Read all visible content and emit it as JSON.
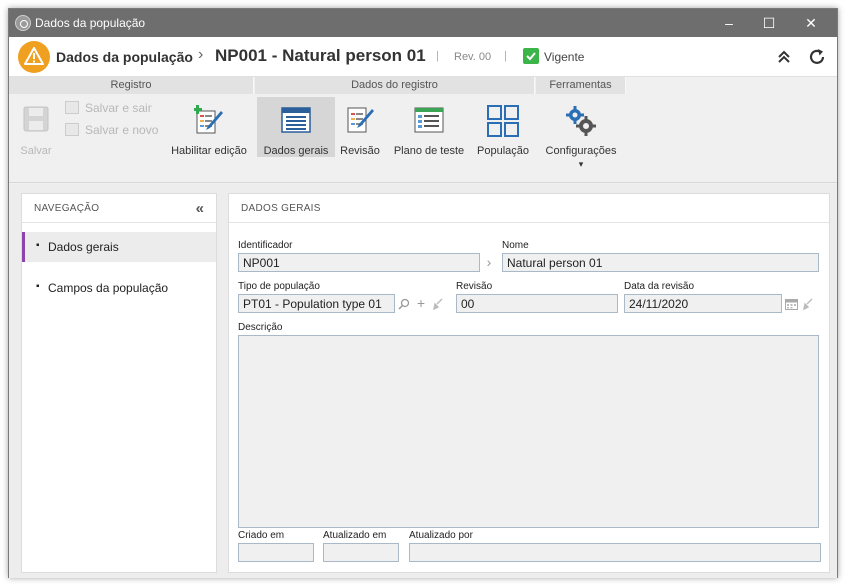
{
  "window": {
    "title": "Dados da população",
    "controls": {
      "minimize": "–",
      "maximize": "☐",
      "close": "✕"
    }
  },
  "header": {
    "module": "Dados da população",
    "separator": "›",
    "record": "NP001 - Natural person 01",
    "pipe": "|",
    "revision": "Rev. 00",
    "status": "Vigente",
    "status_color": "#3bb54a",
    "badge_color": "#f0a020"
  },
  "ribbon": {
    "groups": [
      {
        "title": "Registro"
      },
      {
        "title": "Dados do registro"
      },
      {
        "title": "Ferramentas"
      }
    ],
    "registro": {
      "save": "Salvar",
      "save_exit": "Salvar e sair",
      "save_new": "Salvar e novo",
      "enable_edit": "Habilitar edição"
    },
    "dados": {
      "general": "Dados gerais",
      "revision": "Revisão",
      "test_plan": "Plano de teste",
      "population": "População"
    },
    "ferramentas": {
      "settings": "Configurações",
      "caret": "▾"
    }
  },
  "nav": {
    "title": "NAVEGAÇÃO",
    "collapse": "«",
    "bullet": "▪",
    "items": [
      {
        "label": "Dados gerais"
      },
      {
        "label": "Campos da população"
      }
    ]
  },
  "form": {
    "section": "DADOS GERAIS",
    "identifier": {
      "label": "Identificador",
      "value": "NP001"
    },
    "name": {
      "label": "Nome",
      "value": "Natural person 01"
    },
    "population_type": {
      "label": "Tipo de população",
      "value": "PT01 - Population type 01"
    },
    "revision": {
      "label": "Revisão",
      "value": "00"
    },
    "revision_date": {
      "label": "Data da revisão",
      "value": "24/11/2020"
    },
    "description": {
      "label": "Descrição",
      "value": ""
    },
    "created_on": {
      "label": "Criado em",
      "value": ""
    },
    "updated_on": {
      "label": "Atualizado em",
      "value": ""
    },
    "updated_by": {
      "label": "Atualizado por",
      "value": ""
    }
  }
}
